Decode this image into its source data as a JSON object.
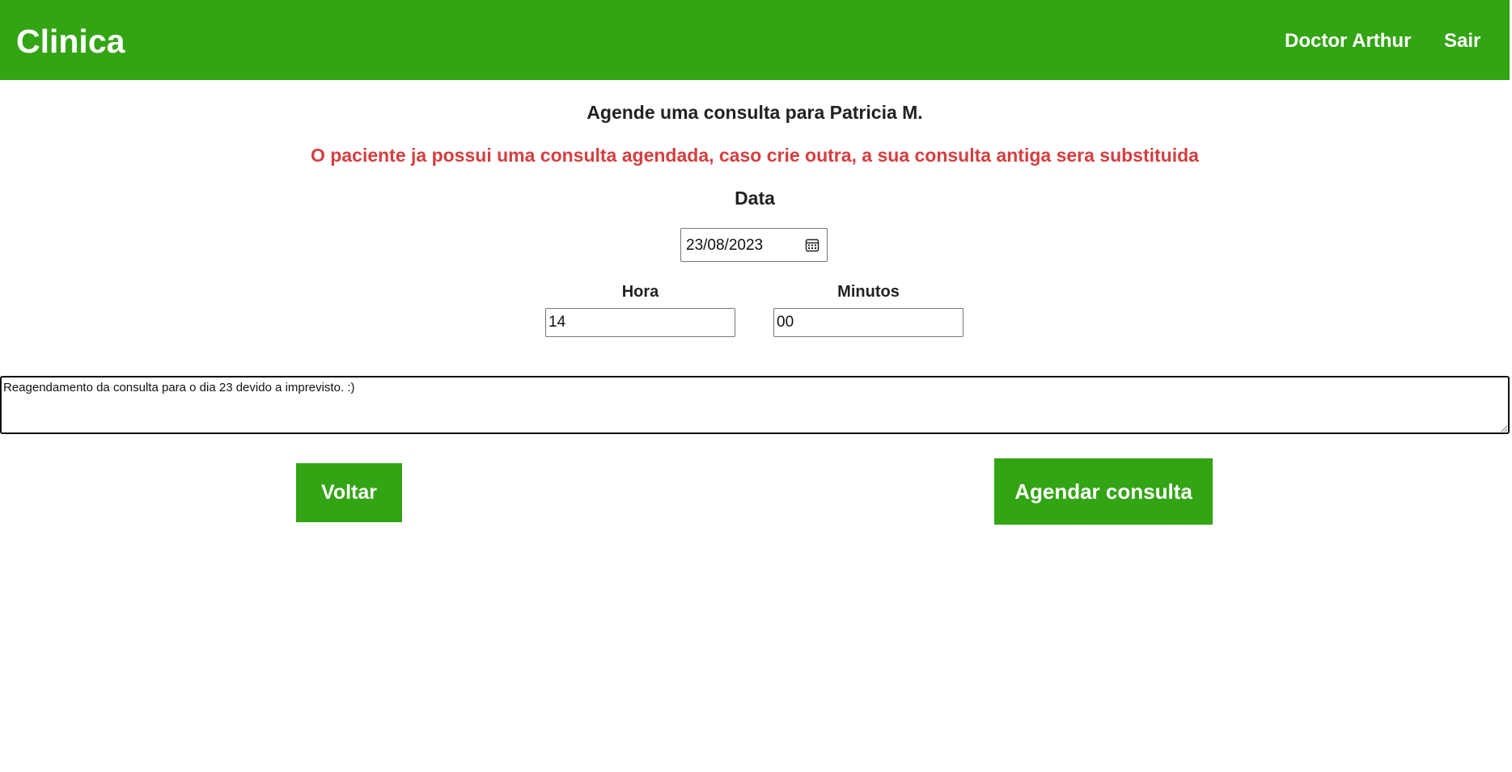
{
  "header": {
    "brand": "Clinica",
    "user_name": "Doctor Arthur",
    "logout_label": "Sair"
  },
  "main": {
    "title": "Agende uma consulta para Patricia M.",
    "warning": "O paciente ja possui uma consulta agendada, caso crie outra, a sua consulta antiga sera substituida",
    "date_label": "Data",
    "date_value": "23/08/2023",
    "date_icon": "calendar-icon",
    "hour_label": "Hora",
    "hour_value": "14",
    "minutes_label": "Minutos",
    "minutes_value": "00",
    "notes_value": "Reagendamento da consulta para o dia 23 devido a imprevisto. :)"
  },
  "actions": {
    "back_label": "Voltar",
    "schedule_label": "Agendar consulta"
  },
  "colors": {
    "brand_green": "#33a414",
    "warning_red": "#d43f3f",
    "text_dark": "#222222"
  }
}
